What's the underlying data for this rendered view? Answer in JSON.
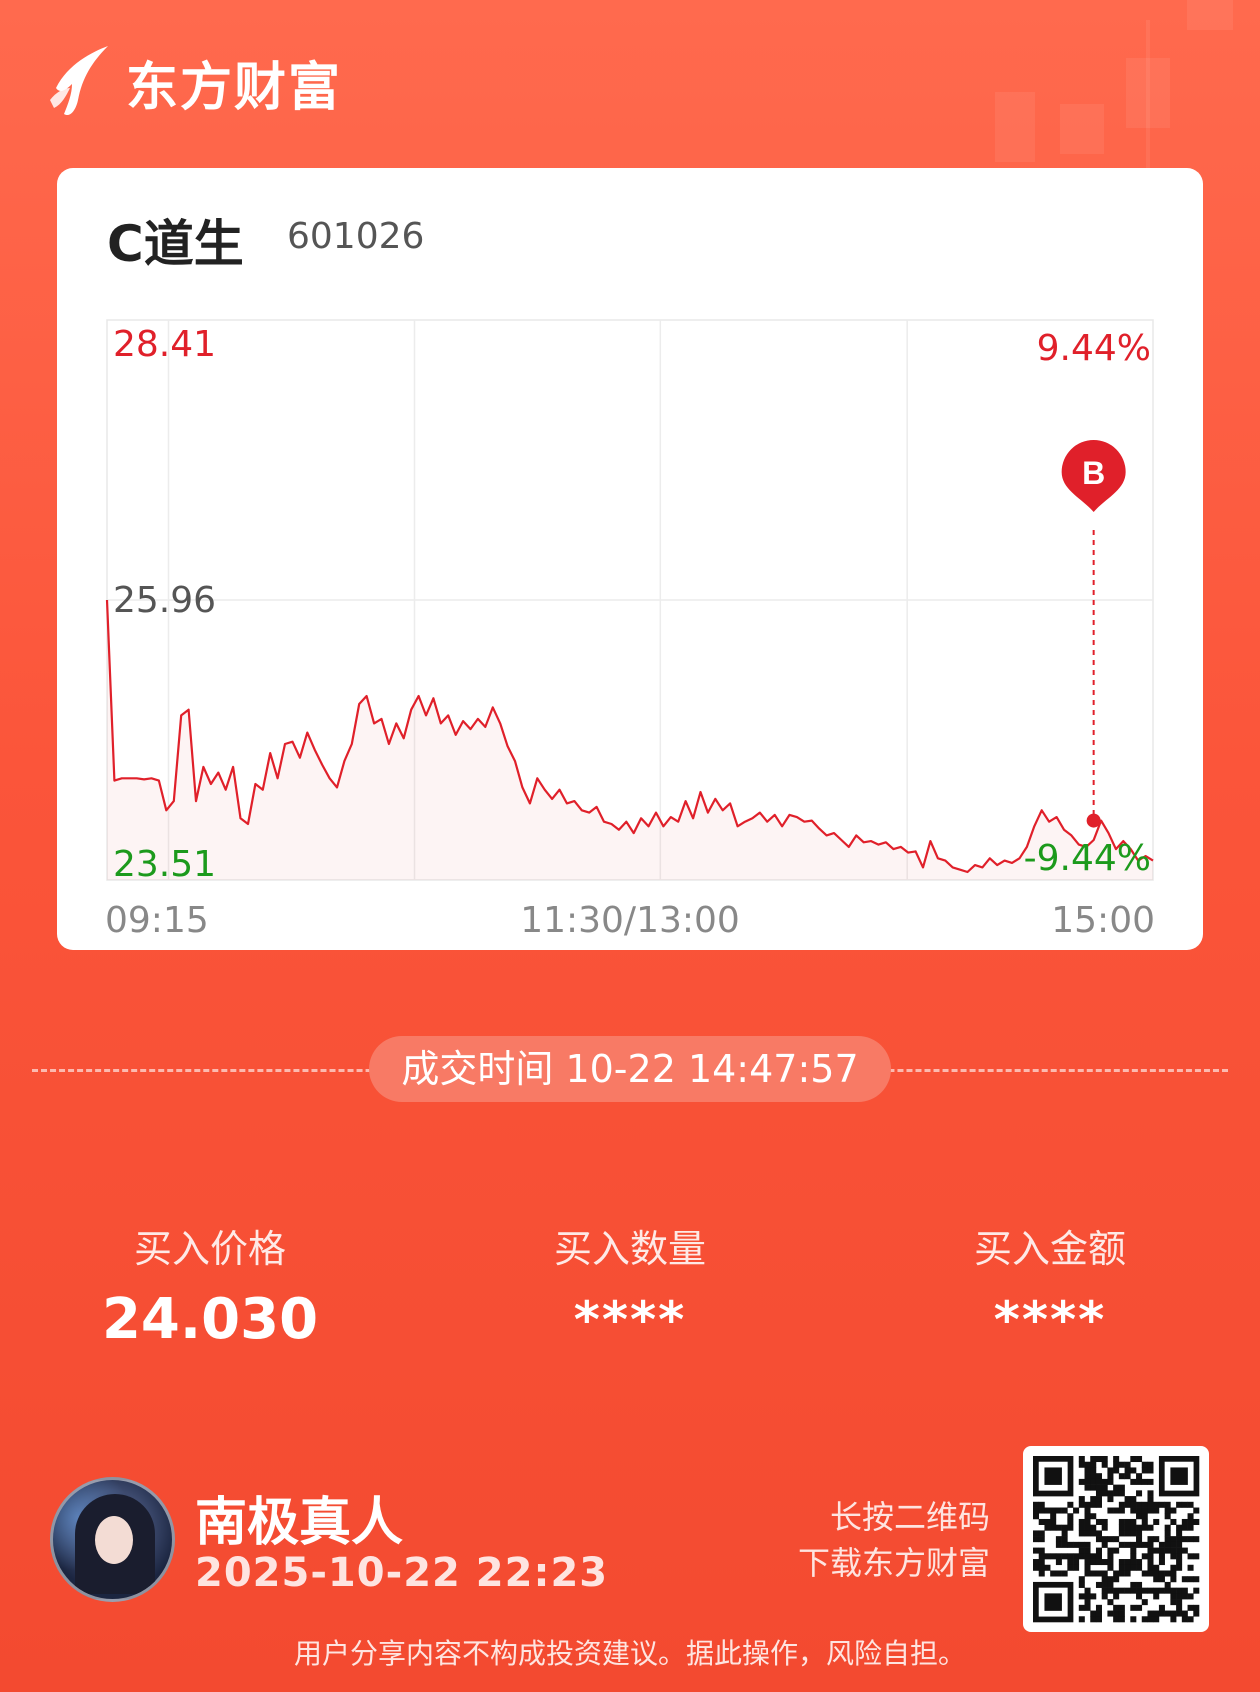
{
  "brand": {
    "name": "东方财富",
    "logo_icon": "eastmoney-logo-icon"
  },
  "stock": {
    "name": "C道生",
    "code": "601026"
  },
  "chart_data": {
    "type": "line",
    "title": "",
    "xlabel": "",
    "ylabel": "",
    "x_tick_labels": [
      "09:15",
      "11:30/13:00",
      "15:00"
    ],
    "y_tick_labels": {
      "top": "28.41",
      "mid": "25.96",
      "bottom": "23.51"
    },
    "pct_labels": {
      "top": "9.44%",
      "bottom": "-9.44%"
    },
    "ylim": [
      23.51,
      28.41
    ],
    "prev_close": 25.96,
    "grid": true,
    "colors": {
      "up": "#e0202a",
      "down": "#1c9a1c",
      "mid": "#555555",
      "line": "#e0202a"
    },
    "series": [
      {
        "values": [
          25.96,
          24.38,
          24.4,
          24.4,
          24.4,
          24.39,
          24.4,
          24.38,
          24.12,
          24.2,
          24.95,
          25.0,
          24.2,
          24.5,
          24.35,
          24.45,
          24.3,
          24.5,
          24.05,
          24.0,
          24.35,
          24.3,
          24.62,
          24.4,
          24.7,
          24.72,
          24.58,
          24.8,
          24.65,
          24.52,
          24.4,
          24.32,
          24.55,
          24.7,
          25.05,
          25.12,
          24.88,
          24.92,
          24.7,
          24.88,
          24.75,
          25.0,
          25.12,
          24.95,
          25.1,
          24.88,
          24.95,
          24.78,
          24.9,
          24.83,
          24.92,
          24.85,
          25.02,
          24.88,
          24.68,
          24.55,
          24.32,
          24.18,
          24.4,
          24.3,
          24.22,
          24.3,
          24.18,
          24.2,
          24.12,
          24.1,
          24.15,
          24.02,
          24.0,
          23.95,
          24.02,
          23.92,
          24.05,
          23.98,
          24.1,
          23.98,
          24.06,
          24.02,
          24.2,
          24.05,
          24.28,
          24.1,
          24.22,
          24.12,
          24.18,
          23.98,
          24.02,
          24.05,
          24.1,
          24.02,
          24.08,
          23.98,
          24.08,
          24.06,
          24.02,
          24.03,
          23.96,
          23.9,
          23.92,
          23.86,
          23.8,
          23.9,
          23.84,
          23.85,
          23.82,
          23.84,
          23.78,
          23.8,
          23.75,
          23.76,
          23.62,
          23.85,
          23.7,
          23.68,
          23.62,
          23.6,
          23.58,
          23.64,
          23.62,
          23.7,
          23.64,
          23.68,
          23.66,
          23.7,
          23.8,
          23.98,
          24.12,
          24.02,
          24.06,
          23.95,
          23.9,
          23.82,
          23.8,
          23.86,
          24.03,
          23.92,
          23.78,
          23.85,
          23.78,
          23.68,
          23.72,
          23.68
        ]
      }
    ],
    "buy_marker": {
      "label": "B",
      "index": 133,
      "price": 24.03,
      "time": "14:47:57"
    }
  },
  "trade": {
    "time_label": "成交时间 10-22 14:47:57",
    "price_label": "买入价格",
    "price_value": "24.030",
    "qty_label": "买入数量",
    "qty_value": "****",
    "amount_label": "买入金额",
    "amount_value": "****"
  },
  "user": {
    "name": "南极真人",
    "datetime": "2025-10-22 22:23",
    "qr_line1": "长按二维码",
    "qr_line2": "下载东方财富"
  },
  "footer": {
    "disclaimer": "用户分享内容不构成投资建议。据此操作，风险自担。"
  }
}
